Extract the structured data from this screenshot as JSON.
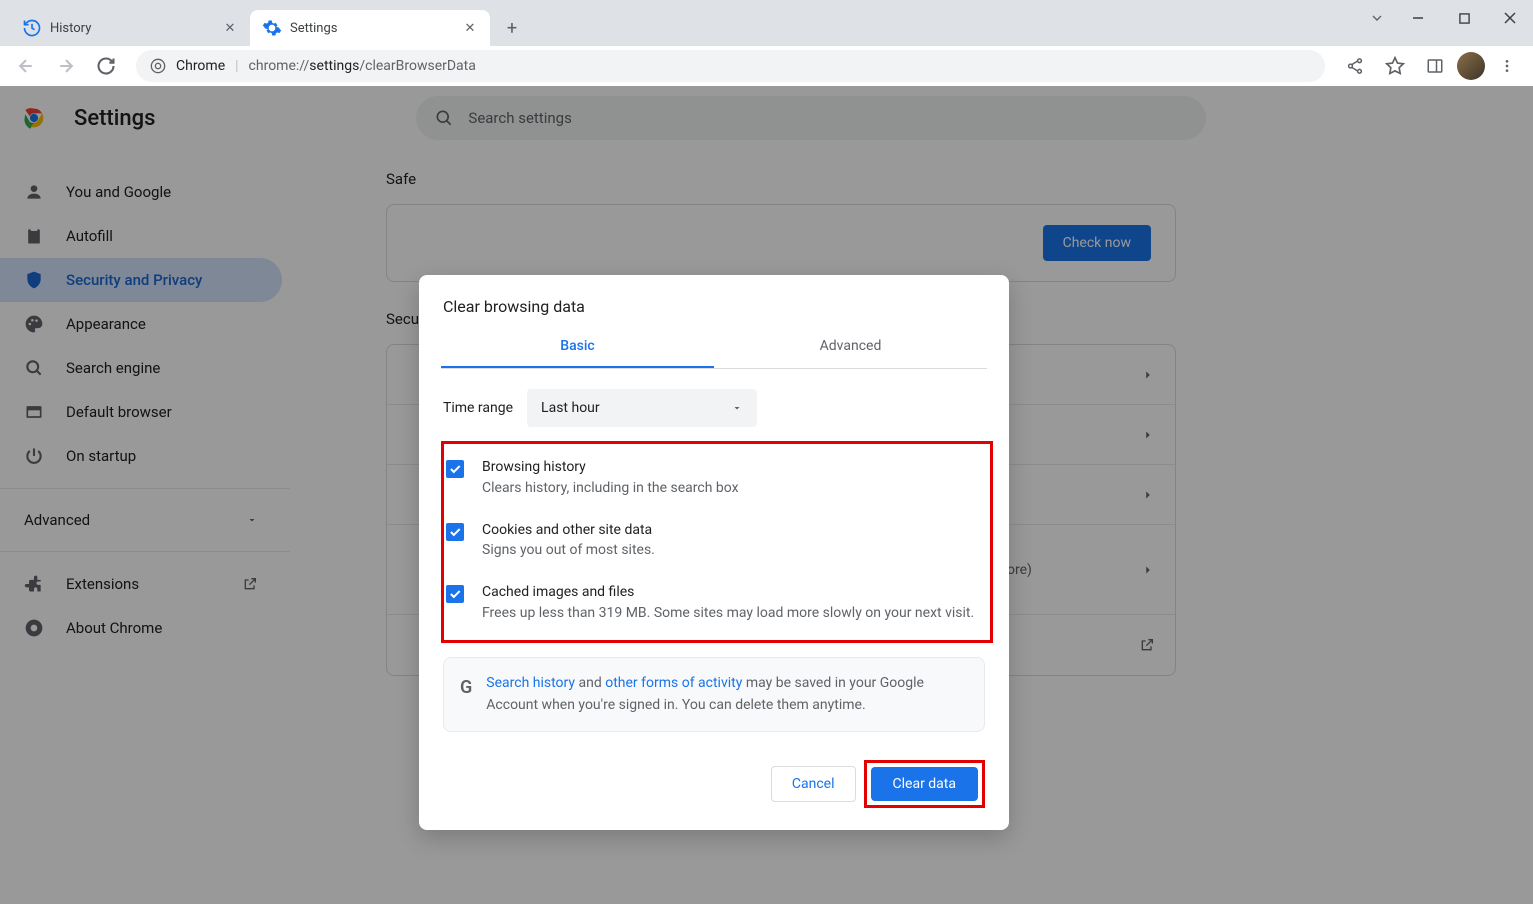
{
  "tabs": {
    "history": "History",
    "settings": "Settings"
  },
  "omnibox": {
    "scheme": "Chrome",
    "path_prefix": "chrome://",
    "path_bold": "settings",
    "path_suffix": "/clearBrowserData"
  },
  "page": {
    "title": "Settings",
    "search_placeholder": "Search settings"
  },
  "sidebar": {
    "you_and_google": "You and Google",
    "autofill": "Autofill",
    "security_privacy": "Security and Privacy",
    "appearance": "Appearance",
    "search_engine": "Search engine",
    "default_browser": "Default browser",
    "on_startup": "On startup",
    "advanced": "Advanced",
    "extensions": "Extensions",
    "about_chrome": "About Chrome"
  },
  "main": {
    "safety_section": "Safe",
    "check_now": "Check now",
    "security_section": "Secu",
    "more_suffix": "ore)"
  },
  "dialog": {
    "title": "Clear browsing data",
    "tab_basic": "Basic",
    "tab_advanced": "Advanced",
    "time_range_label": "Time range",
    "time_range_value": "Last hour",
    "options": {
      "browsing": {
        "title": "Browsing history",
        "desc": "Clears history, including in the search box"
      },
      "cookies": {
        "title": "Cookies and other site data",
        "desc": "Signs you out of most sites."
      },
      "cache": {
        "title": "Cached images and files",
        "desc": "Frees up less than 319 MB. Some sites may load more slowly on your next visit."
      }
    },
    "info": {
      "link_search": "Search history",
      "mid_text": " and ",
      "link_activity": "other forms of activity",
      "rest": " may be saved in your Google Account when you're signed in. You can delete them anytime."
    },
    "cancel": "Cancel",
    "clear": "Clear data"
  }
}
